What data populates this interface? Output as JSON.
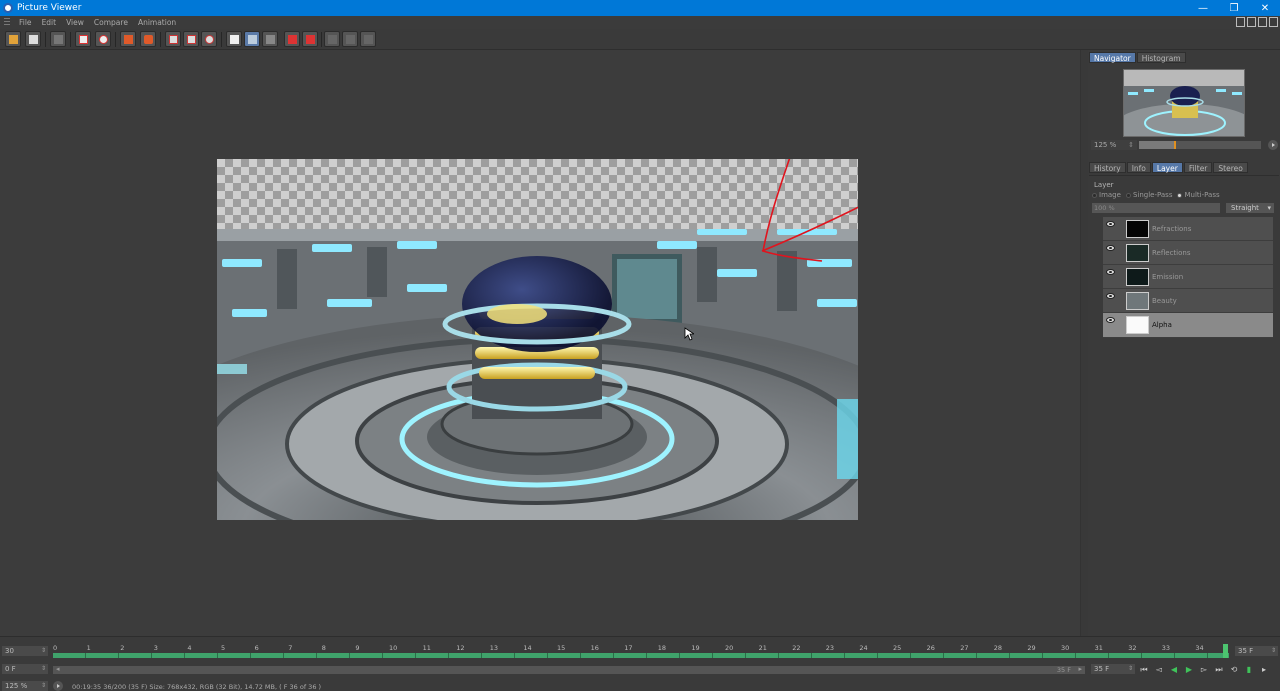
{
  "window": {
    "title": "Picture Viewer",
    "minimize": "—",
    "restore": "❐",
    "close": "✕"
  },
  "menu": {
    "items": [
      "File",
      "Edit",
      "View",
      "Compare",
      "Animation"
    ]
  },
  "toolbar": {
    "buttons": [
      "open-icon",
      "save-icon",
      "stop-icon",
      "grid-icon",
      "settings-icon",
      "export-icon",
      "export-alt-icon",
      "zoom-fit-icon",
      "zoom-region-icon",
      "zoom-reset-icon",
      "ab-icon",
      "compare-split-icon",
      "compare-ab-icon",
      "swap-a-icon",
      "swap-b-icon",
      "color-a-icon",
      "color-b-icon",
      "color-c-icon"
    ]
  },
  "navigator": {
    "tabs": [
      "Navigator",
      "Histogram"
    ],
    "active_tab": "Navigator",
    "zoom_label": "125 %",
    "zoom_fraction": 0.29
  },
  "panel": {
    "tabs": [
      "History",
      "Info",
      "Layer",
      "Filter",
      "Stereo"
    ],
    "active_tab": "Layer",
    "section_label": "Layer",
    "modes": [
      "Image",
      "Single-Pass",
      "Multi-Pass"
    ],
    "active_mode": "Multi-Pass",
    "opacity": "100 %",
    "blend_mode": "Straight",
    "layers": [
      {
        "name": "Refractions",
        "selected": false
      },
      {
        "name": "Reflections",
        "selected": false
      },
      {
        "name": "Emission",
        "selected": false
      },
      {
        "name": "Beauty",
        "selected": false
      },
      {
        "name": "Alpha",
        "selected": true
      }
    ]
  },
  "timeline": {
    "frame_field": "30",
    "start_field": "0 F",
    "end_field": "35 F",
    "end_field2": "35 F",
    "scroll_label": "35 F",
    "ticks": [
      "0",
      "1",
      "2",
      "3",
      "4",
      "5",
      "6",
      "7",
      "8",
      "9",
      "10",
      "11",
      "12",
      "13",
      "14",
      "15",
      "16",
      "17",
      "18",
      "19",
      "20",
      "21",
      "22",
      "23",
      "24",
      "25",
      "26",
      "27",
      "28",
      "29",
      "30",
      "31",
      "32",
      "33",
      "34"
    ],
    "zoom_field": "125 %",
    "status_text": "00:19:35  36/200 (35 F)     Size: 768x432, RGB (32 Bit), 14.72 MB,  ( F 36 of 36 )"
  },
  "colors": {
    "title_bar": "#0078d7",
    "annotation_arrow": "#e0141e",
    "timeline_green": "#3fa36b",
    "tab_selected": "#5678a8"
  }
}
